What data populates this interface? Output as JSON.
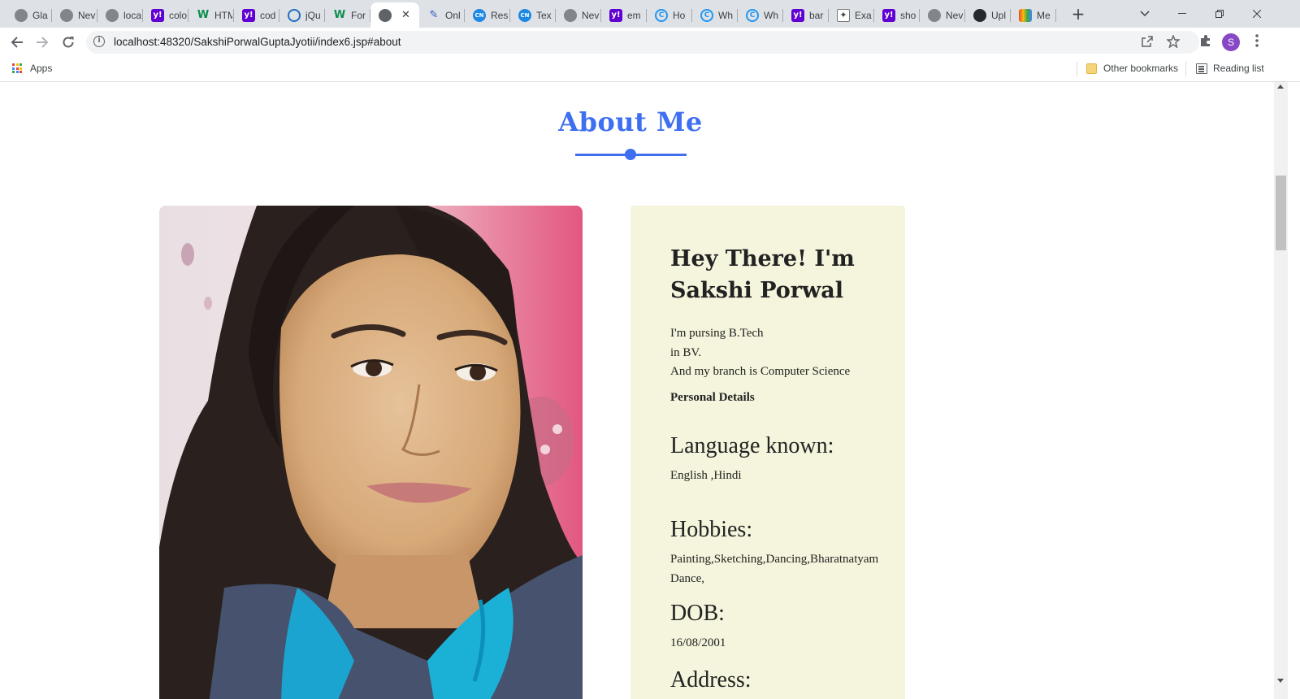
{
  "browser": {
    "tabs": [
      {
        "favicon": "globe-icon",
        "title": "Gla"
      },
      {
        "favicon": "globe-icon",
        "title": "Nev"
      },
      {
        "favicon": "globe-icon",
        "title": "loca"
      },
      {
        "favicon": "yahoo-icon",
        "title": "colo"
      },
      {
        "favicon": "w3schools-icon",
        "title": "HTM"
      },
      {
        "favicon": "yahoo-icon",
        "title": "cod"
      },
      {
        "favicon": "jquery-icon",
        "title": "jQu"
      },
      {
        "favicon": "w3schools-icon",
        "title": "For"
      },
      {
        "favicon": "globe-icon",
        "title": "",
        "active": true
      },
      {
        "favicon": "pen-icon",
        "title": "Onl"
      },
      {
        "favicon": "codingninjas-icon",
        "title": "Res"
      },
      {
        "favicon": "codingninjas-icon",
        "title": "Tex"
      },
      {
        "favicon": "globe-icon",
        "title": "Nev"
      },
      {
        "favicon": "yahoo-icon",
        "title": "em"
      },
      {
        "favicon": "c-icon",
        "title": "Ho"
      },
      {
        "favicon": "c-icon",
        "title": "Wh"
      },
      {
        "favicon": "c-icon",
        "title": "Wh"
      },
      {
        "favicon": "yahoo-icon",
        "title": "bar"
      },
      {
        "favicon": "star-icon",
        "title": "Exa"
      },
      {
        "favicon": "yahoo-icon",
        "title": "sho"
      },
      {
        "favicon": "globe-icon",
        "title": "Nev"
      },
      {
        "favicon": "github-icon",
        "title": "Upl"
      },
      {
        "favicon": "meet-icon",
        "title": "Me"
      }
    ],
    "url": "localhost:48320/SakshiPorwalGuptaJyotii/index6.jsp#about",
    "profile_initial": "S",
    "bookmarks": {
      "apps_label": "Apps",
      "other_label": "Other bookmarks",
      "reading_label": "Reading list"
    }
  },
  "page": {
    "section_title": "About Me",
    "card": {
      "heading": "Hey There! I'm Sakshi Porwal",
      "intro_lines": [
        "I'm pursing B.Tech",
        "in BV.",
        "And my branch is Computer Science"
      ],
      "personal_details_label": "Personal Details",
      "details": [
        {
          "label": "Language known:",
          "value": "English ,Hindi"
        },
        {
          "label": "Hobbies:",
          "value": "Painting,Sketching,Dancing,Bharatnatyam Dance,"
        },
        {
          "label": "DOB:",
          "value": "16/08/2001"
        },
        {
          "label": "Address:",
          "value": ""
        }
      ]
    }
  },
  "colors": {
    "accent": "#3e6ff0",
    "card_bg": "#f5f4dc",
    "tabstrip_bg": "#dee1e6"
  }
}
